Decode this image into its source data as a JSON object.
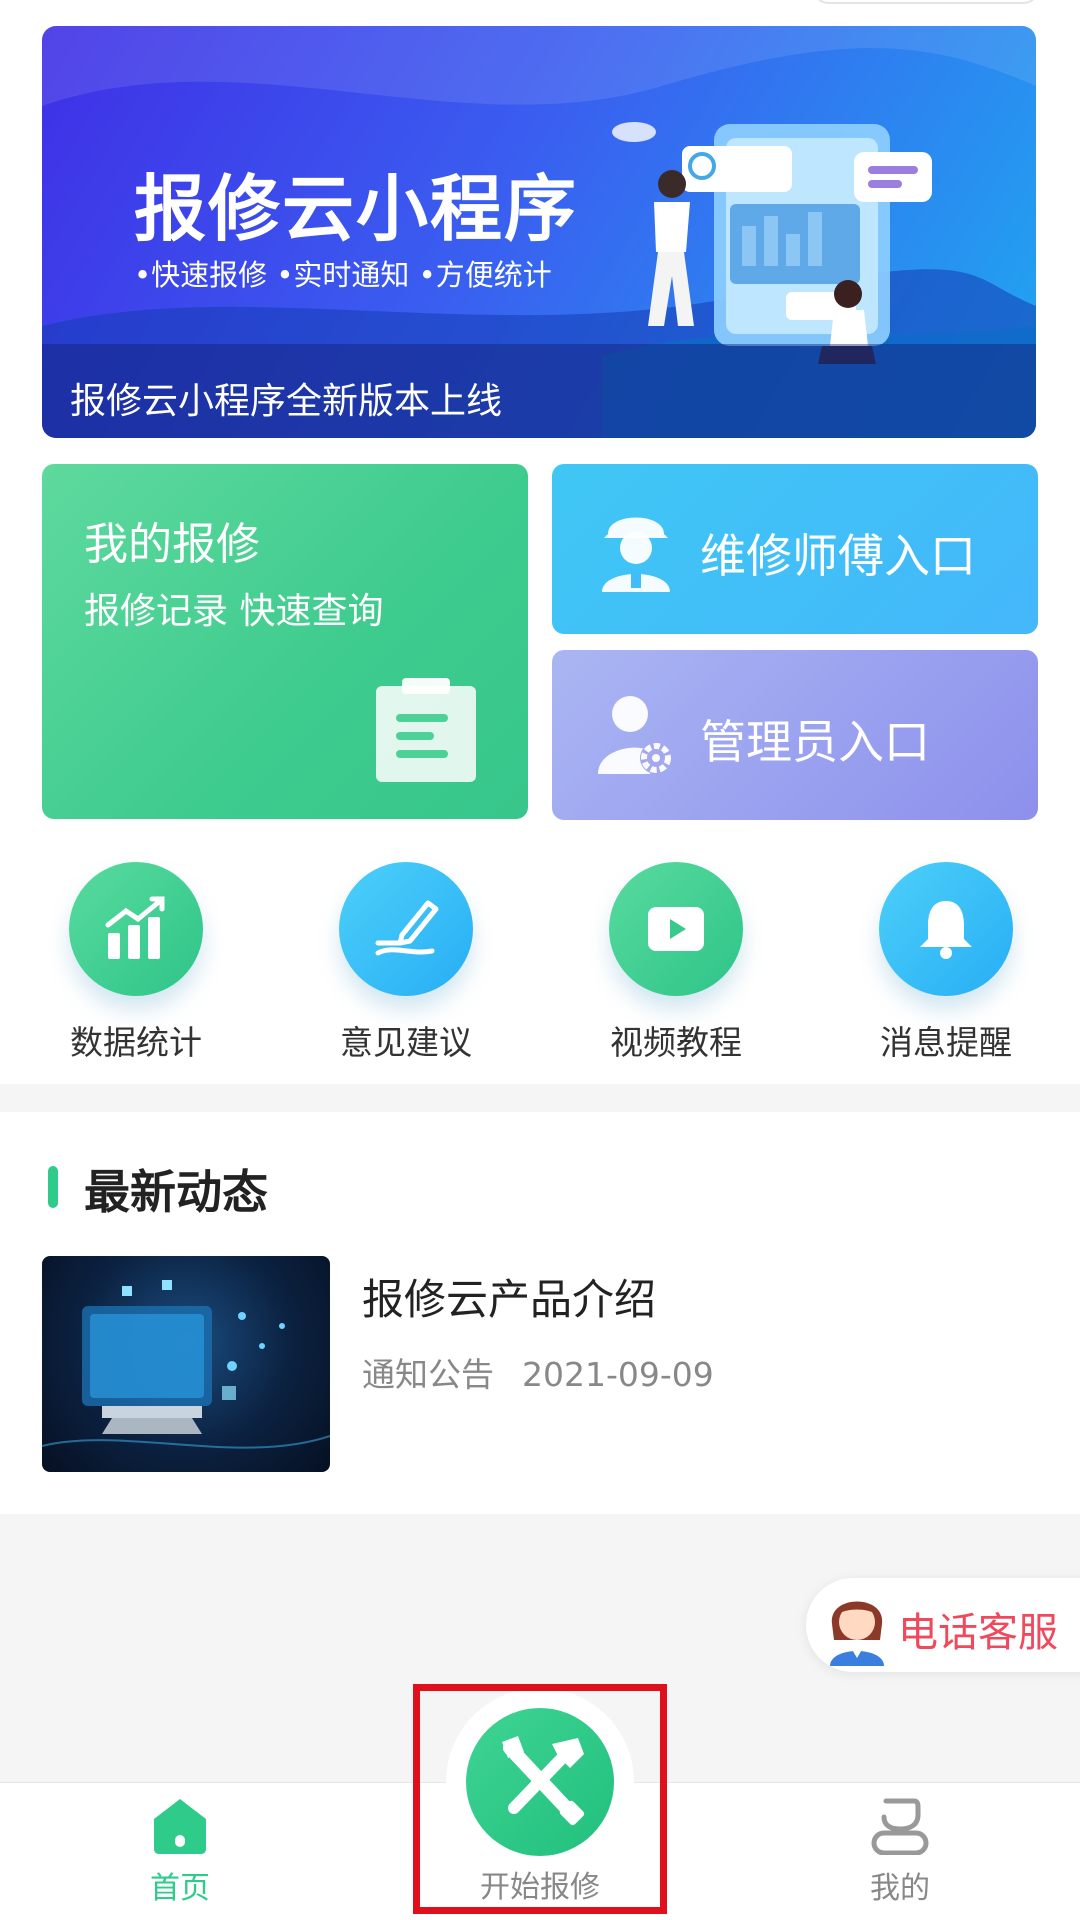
{
  "banner": {
    "title": "报修云小程序",
    "subtitle": "•快速报修 •实时通知 •方便统计",
    "caption": "报修云小程序全新版本上线"
  },
  "cards": {
    "my_repair": {
      "title": "我的报修",
      "subtitle": "报修记录 快速查询",
      "icon": "clipboard-icon"
    },
    "technician": {
      "label": "维修师傅入口",
      "icon": "worker-icon"
    },
    "admin": {
      "label": "管理员入口",
      "icon": "admin-gear-icon"
    }
  },
  "quick_actions": [
    {
      "label": "数据统计",
      "icon": "bar-chart-icon"
    },
    {
      "label": "意见建议",
      "icon": "pen-icon"
    },
    {
      "label": "视频教程",
      "icon": "play-icon"
    },
    {
      "label": "消息提醒",
      "icon": "bell-icon"
    }
  ],
  "news": {
    "heading": "最新动态",
    "items": [
      {
        "title": "报修云产品介绍",
        "category": "通知公告",
        "date": "2021-09-09"
      }
    ]
  },
  "phone_service": {
    "label": "电话客服"
  },
  "tabbar": {
    "home": "首页",
    "start_repair": "开始报修",
    "mine": "我的"
  },
  "colors": {
    "accent": "#2ecb8b",
    "highlight": "#e00f1c",
    "phone_text": "#f0495c"
  }
}
